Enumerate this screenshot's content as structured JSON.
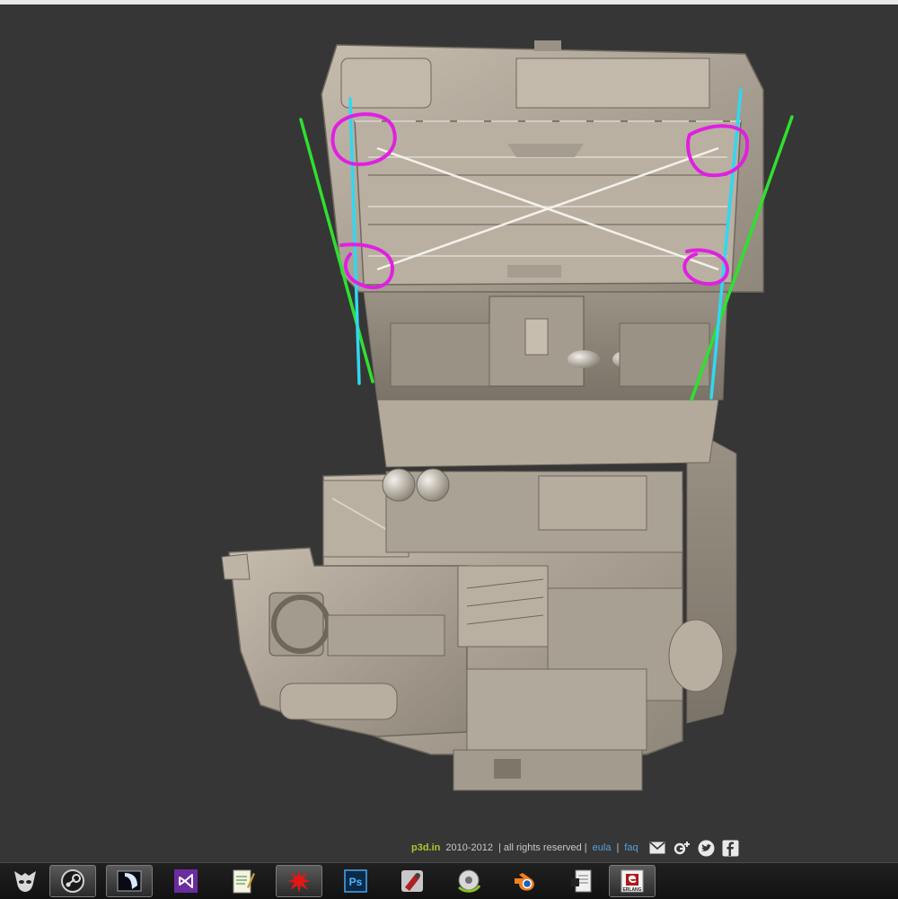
{
  "footer": {
    "brand": "p3d.in",
    "years": "2010-2012",
    "rights": "| all rights reserved |",
    "eula": "eula",
    "sep": "|",
    "faq": "faq"
  },
  "icons": {
    "social": [
      "email-icon",
      "google-plus-icon",
      "twitter-icon",
      "facebook-icon"
    ],
    "taskbar": [
      "foobar-app-icon",
      "steam-icon",
      "app-window-icon",
      "visual-studio-icon",
      "notepad-plus-icon",
      "paint-splatter-icon",
      "photoshop-icon",
      "tool-app-icon",
      "gimp-icon",
      "blender-icon",
      "document-app-icon",
      "erlang-icon"
    ]
  },
  "taskbar": {
    "photoshop_label": "Ps",
    "erlang_label": "ERLANG"
  },
  "colors": {
    "background": "#363636",
    "annotation_magenta": "#e020e0",
    "annotation_cyan": "#30d8f0",
    "annotation_green": "#30e030",
    "model": "#aea596"
  }
}
